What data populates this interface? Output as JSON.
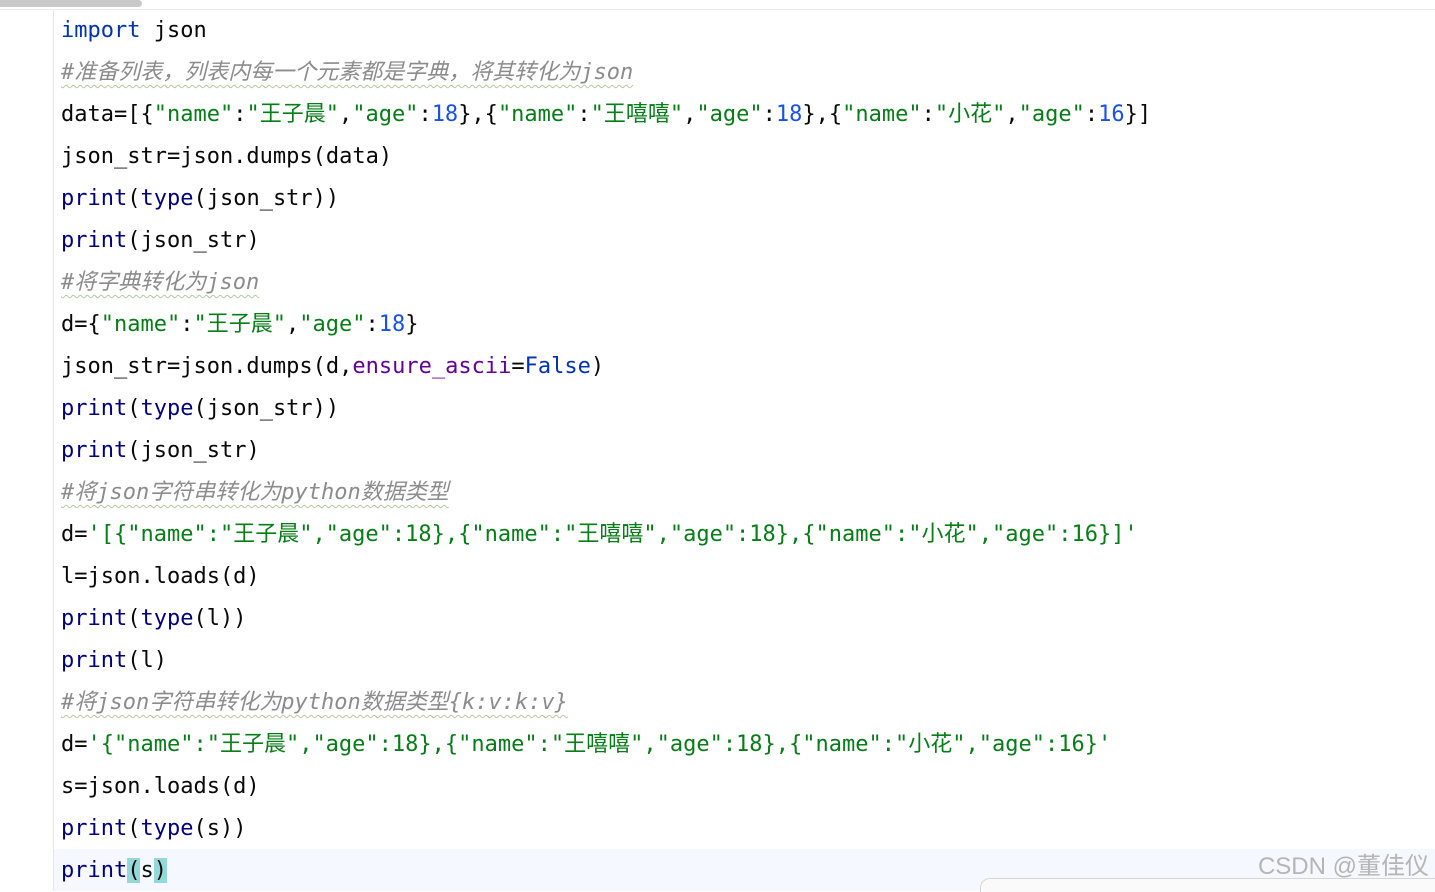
{
  "code_lines": [
    {
      "tokens": [
        {
          "t": "import",
          "c": "kw"
        },
        {
          "t": " json",
          "c": ""
        }
      ]
    },
    {
      "tokens": [
        {
          "t": "#准备列表，列表内每一个元素都是字典，将其转化为json",
          "c": "cmt squig"
        }
      ]
    },
    {
      "tokens": [
        {
          "t": "data=[{",
          "c": ""
        },
        {
          "t": "\"name\"",
          "c": "str"
        },
        {
          "t": ":",
          "c": ""
        },
        {
          "t": "\"王子晨\"",
          "c": "str"
        },
        {
          "t": ",",
          "c": ""
        },
        {
          "t": "\"age\"",
          "c": "str"
        },
        {
          "t": ":",
          "c": ""
        },
        {
          "t": "18",
          "c": "num"
        },
        {
          "t": "},{",
          "c": ""
        },
        {
          "t": "\"name\"",
          "c": "str"
        },
        {
          "t": ":",
          "c": ""
        },
        {
          "t": "\"王嘻嘻\"",
          "c": "str"
        },
        {
          "t": ",",
          "c": ""
        },
        {
          "t": "\"age\"",
          "c": "str"
        },
        {
          "t": ":",
          "c": ""
        },
        {
          "t": "18",
          "c": "num"
        },
        {
          "t": "},{",
          "c": ""
        },
        {
          "t": "\"name\"",
          "c": "str"
        },
        {
          "t": ":",
          "c": ""
        },
        {
          "t": "\"小花\"",
          "c": "str"
        },
        {
          "t": ",",
          "c": ""
        },
        {
          "t": "\"age\"",
          "c": "str"
        },
        {
          "t": ":",
          "c": ""
        },
        {
          "t": "16",
          "c": "num"
        },
        {
          "t": "}]",
          "c": ""
        }
      ]
    },
    {
      "tokens": [
        {
          "t": "json_str=json.dumps(data)",
          "c": ""
        }
      ]
    },
    {
      "tokens": [
        {
          "t": "print",
          "c": "bi"
        },
        {
          "t": "(",
          "c": ""
        },
        {
          "t": "type",
          "c": "bi"
        },
        {
          "t": "(json_str))",
          "c": ""
        }
      ]
    },
    {
      "tokens": [
        {
          "t": "print",
          "c": "bi"
        },
        {
          "t": "(json_str)",
          "c": ""
        }
      ]
    },
    {
      "tokens": [
        {
          "t": "#将字典转化为json",
          "c": "cmt squig"
        }
      ]
    },
    {
      "tokens": [
        {
          "t": "d={",
          "c": ""
        },
        {
          "t": "\"name\"",
          "c": "str"
        },
        {
          "t": ":",
          "c": ""
        },
        {
          "t": "\"王子晨\"",
          "c": "str"
        },
        {
          "t": ",",
          "c": ""
        },
        {
          "t": "\"age\"",
          "c": "str"
        },
        {
          "t": ":",
          "c": ""
        },
        {
          "t": "18",
          "c": "num"
        },
        {
          "t": "}",
          "c": ""
        }
      ]
    },
    {
      "tokens": [
        {
          "t": "json_str=json.dumps(d,",
          "c": ""
        },
        {
          "t": "ensure_ascii",
          "c": "param"
        },
        {
          "t": "=",
          "c": ""
        },
        {
          "t": "False",
          "c": "kw"
        },
        {
          "t": ")",
          "c": ""
        }
      ]
    },
    {
      "tokens": [
        {
          "t": "print",
          "c": "bi"
        },
        {
          "t": "(",
          "c": ""
        },
        {
          "t": "type",
          "c": "bi"
        },
        {
          "t": "(json_str))",
          "c": ""
        }
      ]
    },
    {
      "tokens": [
        {
          "t": "print",
          "c": "bi"
        },
        {
          "t": "(json_str)",
          "c": ""
        }
      ]
    },
    {
      "tokens": [
        {
          "t": "#将json字符串转化为python数据类型",
          "c": "cmt squig"
        }
      ]
    },
    {
      "tokens": [
        {
          "t": "d=",
          "c": ""
        },
        {
          "t": "'[{\"name\":\"王子晨\",\"age\":18},{\"name\":\"王嘻嘻\",\"age\":18},{\"name\":\"小花\",\"age\":16}]'",
          "c": "str"
        }
      ]
    },
    {
      "tokens": [
        {
          "t": "l=json.loads(d)",
          "c": ""
        }
      ]
    },
    {
      "tokens": [
        {
          "t": "print",
          "c": "bi"
        },
        {
          "t": "(",
          "c": ""
        },
        {
          "t": "type",
          "c": "bi"
        },
        {
          "t": "(l))",
          "c": ""
        }
      ]
    },
    {
      "tokens": [
        {
          "t": "print",
          "c": "bi"
        },
        {
          "t": "(l)",
          "c": ""
        }
      ]
    },
    {
      "tokens": [
        {
          "t": "#将json字符串转化为python数据类型{k:v:k:v}",
          "c": "cmt squig"
        }
      ]
    },
    {
      "tokens": [
        {
          "t": "d=",
          "c": ""
        },
        {
          "t": "'{\"name\":\"王子晨\",\"age\":18},{\"name\":\"王嘻嘻\",\"age\":18},{\"name\":\"小花\",\"age\":16}'",
          "c": "str"
        }
      ]
    },
    {
      "tokens": [
        {
          "t": "s=json.loads(d)",
          "c": ""
        }
      ]
    },
    {
      "tokens": [
        {
          "t": "print",
          "c": "bi"
        },
        {
          "t": "(",
          "c": ""
        },
        {
          "t": "type",
          "c": "bi"
        },
        {
          "t": "(s))",
          "c": ""
        }
      ]
    },
    {
      "tokens": [
        {
          "t": "print",
          "c": "bi"
        },
        {
          "t": "(",
          "c": "paren-hl"
        },
        {
          "t": "s",
          "c": ""
        },
        {
          "t": ")",
          "c": "paren-hl"
        }
      ]
    }
  ],
  "watermark": "CSDN @董佳仪"
}
